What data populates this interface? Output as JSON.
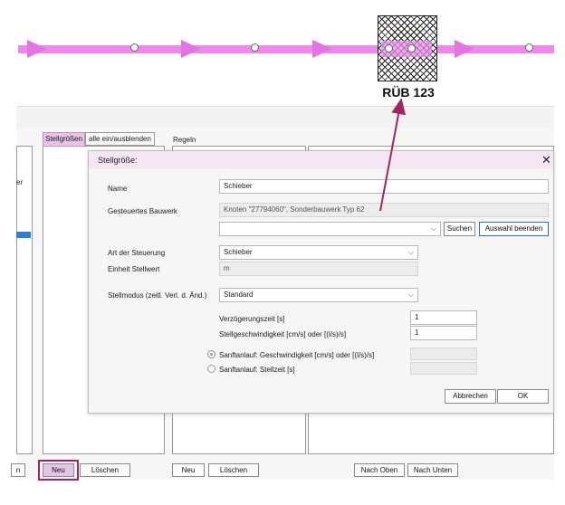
{
  "network": {
    "structure_label": "RÜB 123"
  },
  "panel": {
    "tab_stellgroessen": "Stellgrößen",
    "toggle_all": "alle ein/ausblenden",
    "regeln_label": "Regeln",
    "left_truncated_text": "er",
    "bottom_buttons": {
      "left_partial": "n",
      "neu_1": "Neu",
      "loeschen_1": "Löschen",
      "neu_2": "Neu",
      "loeschen_2": "Löschen",
      "nach_oben": "Nach Oben",
      "nach_unten": "Nach Unten"
    }
  },
  "dialog": {
    "title": "Stellgröße:",
    "close_icon": "close-icon",
    "name_label": "Name",
    "name_value": "Schieber",
    "bauwerk_label": "Gesteuertes Bauwerk",
    "bauwerk_value": "Knoten \"27794060\", Sonderbauwerk Typ 62",
    "bauwerk_select_value": "",
    "suchen_button": "Suchen",
    "auswahl_beenden_button": "Auswahl beenden",
    "art_label": "Art der Steuerung",
    "art_value": "Schieber",
    "einheit_label": "Einheit Stellwert",
    "einheit_value": "m",
    "stellmodus_label": "Stellmodus (zeitl. Verl. d. Änd.)",
    "stellmodus_value": "Standard",
    "verzoegerung_label": "Verzögerungszeit [s]",
    "verzoegerung_value": "1",
    "stellgeschw_label": "Stellgeschwindigkeit [cm/s] oder [(l/s)/s]",
    "stellgeschw_value": "1",
    "sanftanlauf_geschw_label": "Sanftanlauf: Geschwindigkeit [cm/s] oder [(l/s)/s]",
    "sanftanlauf_stellzeit_label": "Sanftanlauf: Stellzeit [s]",
    "abbrechen_button": "Abbrechen",
    "ok_button": "OK"
  },
  "colors": {
    "flow_line": "#ee88ee",
    "highlight_border": "#a0265f",
    "selected_marker": "#2b7fd4"
  }
}
